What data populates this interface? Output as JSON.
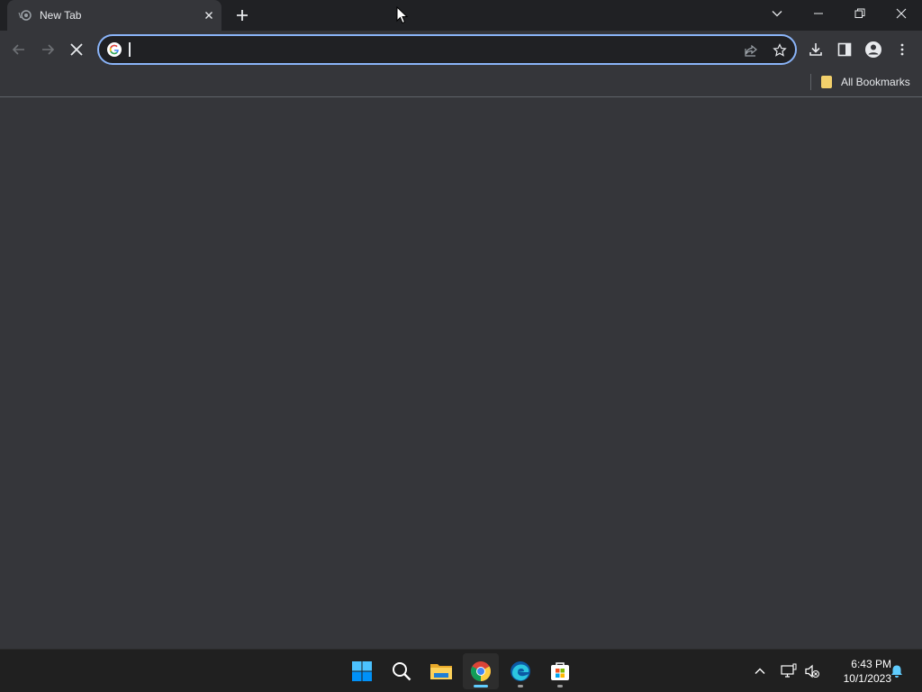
{
  "browser": {
    "tab": {
      "title": "New Tab"
    },
    "omnibox": {
      "value": "",
      "placeholder": ""
    },
    "bookmarks": {
      "all_label": "All Bookmarks"
    },
    "accent_color": "#8ab4f8"
  },
  "taskbar": {
    "apps": [
      {
        "name": "Start",
        "icon": "windows-icon"
      },
      {
        "name": "Search",
        "icon": "search-icon"
      },
      {
        "name": "File Explorer",
        "icon": "folder-icon"
      },
      {
        "name": "Google Chrome",
        "icon": "chrome-icon",
        "active": true
      },
      {
        "name": "Microsoft Edge",
        "icon": "edge-icon"
      },
      {
        "name": "Microsoft Store",
        "icon": "store-icon"
      }
    ],
    "clock": {
      "time": "6:43 PM",
      "date": "10/1/2023"
    }
  }
}
